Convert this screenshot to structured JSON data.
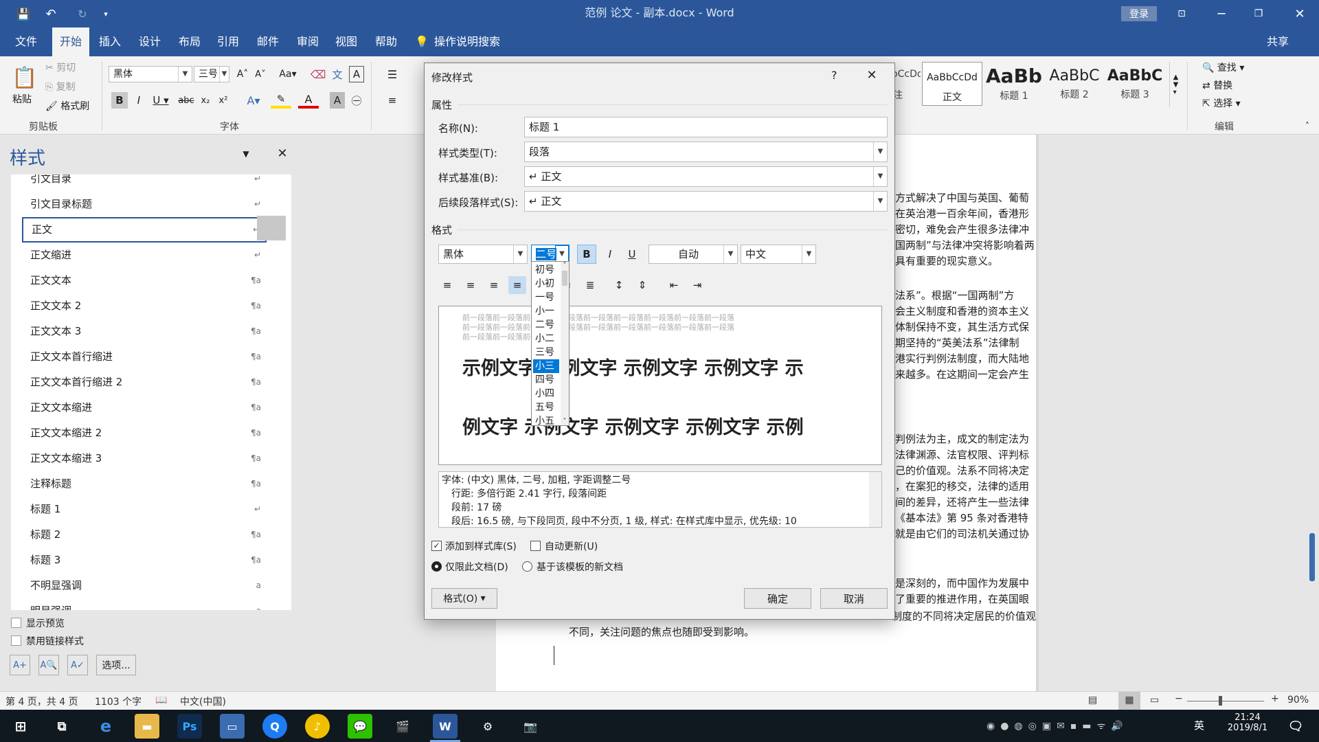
{
  "titlebar": {
    "title": "范例 论文 - 副本.docx - Word",
    "signin": "登录"
  },
  "tabs": [
    "文件",
    "开始",
    "插入",
    "设计",
    "布局",
    "引用",
    "邮件",
    "审阅",
    "视图",
    "帮助"
  ],
  "tellme": "操作说明搜索",
  "share": "共享",
  "ribbon": {
    "clipboard": {
      "paste": "粘贴",
      "cut": "剪切",
      "copy": "复制",
      "painter": "格式刷",
      "group": "剪贴板"
    },
    "font": {
      "name": "黑体",
      "size": "三号",
      "group": "字体"
    },
    "styles": {
      "partial": "AaBbCcDd",
      "p_label": "注",
      "s1_preview": "AaBbCcDd",
      "s1_label": "正文",
      "s2_preview": "AaBb",
      "s2_label": "标题 1",
      "s3_preview": "AaBbC",
      "s3_label": "标题 2",
      "s4_preview": "AaBbC",
      "s4_label": "标题 3"
    },
    "editing": {
      "find": "查找",
      "replace": "替换",
      "select": "选择",
      "group": "编辑"
    }
  },
  "stylespane": {
    "title": "样式",
    "items": [
      {
        "name": "引文目录",
        "mark": "↵"
      },
      {
        "name": "引文目录标题",
        "mark": "↵"
      },
      {
        "name": "正文",
        "mark": "↵"
      },
      {
        "name": "正文缩进",
        "mark": "↵"
      },
      {
        "name": "正文文本",
        "mark": "¶a"
      },
      {
        "name": "正文文本 2",
        "mark": "¶a"
      },
      {
        "name": "正文文本 3",
        "mark": "¶a"
      },
      {
        "name": "正文文本首行缩进",
        "mark": "¶a"
      },
      {
        "name": "正文文本首行缩进 2",
        "mark": "¶a"
      },
      {
        "name": "正文文本缩进",
        "mark": "¶a"
      },
      {
        "name": "正文文本缩进 2",
        "mark": "¶a"
      },
      {
        "name": "正文文本缩进 3",
        "mark": "¶a"
      },
      {
        "name": "注释标题",
        "mark": "¶a"
      },
      {
        "name": "标题 1",
        "mark": "↵"
      },
      {
        "name": "标题 2",
        "mark": "¶a"
      },
      {
        "name": "标题 3",
        "mark": "¶a"
      },
      {
        "name": "不明显强调",
        "mark": "a"
      },
      {
        "name": "明显强调",
        "mark": "a"
      }
    ],
    "show_preview": "显示预览",
    "disable_linked": "禁用链接样式",
    "options": "选项..."
  },
  "doc": {
    "lines1": [
      "方式解决了中国与英国、葡萄",
      "在英治港一百余年间，香港形",
      "密切，难免会产生很多法律冲",
      "国两制”与法律冲突将影响着两",
      "具有重要的现实意义。"
    ],
    "lines2": [
      "法系”。根据“一国两制”方",
      "会主义制度和香港的资本主义",
      "体制保持不变，其生活方式保",
      "期坚持的“英美法系”法律制",
      "港实行判例法制度，而大陆地",
      "来越多。在这期间一定会产生"
    ],
    "lines3": [
      "判例法为主，成文的制定法为",
      "法律渊源、法官权限、评判标",
      "己的价值观。法系不同将决定",
      "，在案犯的移交，法律的适用",
      "间的差异，还将产生一些法律",
      "《基本法》第 95 条对香港特",
      "就是由它们的司法机关通过协"
    ],
    "lines4": [
      "是深刻的，而中国作为发展中",
      "了重要的推进作用，在英国眼"
    ],
    "bottom1": "…制度的不同将决定居民的价值观",
    "bottom2": "不同，关注问题的焦点也随即受到影响。"
  },
  "dialog": {
    "title": "修改样式",
    "help": "?",
    "section_props": "属性",
    "name_label": "名称(N):",
    "name_value": "标题 1",
    "type_label": "样式类型(T):",
    "type_value": "段落",
    "based_label": "样式基准(B):",
    "based_value": "↵ 正文",
    "next_label": "后续段落样式(S):",
    "next_value": "↵ 正文",
    "section_format": "格式",
    "font_value": "黑体",
    "size_value": "二号",
    "color_value": "自动",
    "lang_value": "中文",
    "bold": "B",
    "italic": "I",
    "underline": "U",
    "sizes": [
      "初号",
      "小初",
      "一号",
      "小一",
      "二号",
      "小二",
      "三号",
      "小三",
      "四号",
      "小四",
      "五号",
      "小五"
    ],
    "selected_size": "小三",
    "preview_grey1": "前一段落前一段落前一段落前一段落前一段落前一段落前一段落前一段落前一段落",
    "preview_grey2": "前一段落前一段落前一段落前一段落前一段落前一段落前一段落前一段落前一段落",
    "preview_grey3": "前一段落前一段落前一段落",
    "preview_line1": "示例文字 示例文字 示例文字 示例文字 示",
    "preview_line2": "例文字 示例文字 示例文字 示例文字 示例",
    "desc1": "字体: (中文) 黑体, 二号, 加粗, 字距调整二号",
    "desc2": "行距: 多倍行距 2.41 字行, 段落间距",
    "desc3": "段前: 17 磅",
    "desc4": "段后: 16.5 磅, 与下段同页, 段中不分页, 1 级, 样式: 在样式库中显示, 优先级: 10",
    "add_gallery": "添加到样式库(S)",
    "auto_update": "自动更新(U)",
    "only_doc": "仅限此文档(D)",
    "new_docs": "基于该模板的新文档",
    "format_btn": "格式(O)",
    "ok": "确定",
    "cancel": "取消"
  },
  "status": {
    "page": "第 4 页，共 4 页",
    "words": "1103 个字",
    "lang": "中文(中国)",
    "zoom": "90%"
  },
  "taskbar": {
    "ime": "英",
    "time": "21:24",
    "date": "2019/8/1"
  },
  "colors": {
    "word_blue": "#2b579a",
    "select_blue": "#0078d7"
  }
}
